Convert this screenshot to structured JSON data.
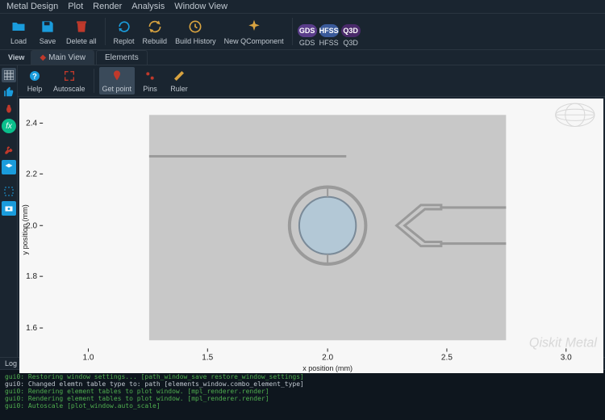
{
  "menu": {
    "items": [
      "Metal Design",
      "Plot",
      "Render",
      "Analysis",
      "Window View"
    ]
  },
  "toolbar": {
    "load": "Load",
    "save": "Save",
    "delete_all": "Delete all",
    "replot": "Replot",
    "rebuild": "Rebuild",
    "build_history": "Build History",
    "new_qc": "New QComponent",
    "gds": "GDS",
    "hfss": "HFSS",
    "q3d": "Q3D"
  },
  "view_label": "View",
  "tabs": {
    "main": "Main View",
    "elements": "Elements"
  },
  "subtoolbar": {
    "help": "Help",
    "autoscale": "Autoscale",
    "get_point": "Get point",
    "pins": "Pins",
    "ruler": "Ruler"
  },
  "plot": {
    "xlabel": "x position (mm)",
    "ylabel": "y position (mm)",
    "watermark": "Qiskit Metal",
    "xticks": [
      "1.0",
      "1.5",
      "2.0",
      "2.5",
      "3.0"
    ],
    "yticks": [
      "1.6",
      "1.8",
      "2.0",
      "2.2",
      "2.4"
    ]
  },
  "log": {
    "header": "Log  (filter >= debug)",
    "lines": [
      {
        "c": "#4fae4f",
        "t": "gui0: Restoring window settings... [path_window_save restore_window_settings]"
      },
      {
        "c": "#c0c8d0",
        "t": "gui0: Changed elemtn table type to:  path [elements_window.combo_element_type]"
      },
      {
        "c": "#4fae4f",
        "t": "gui0: Rendering element tables to plot window. [mpl_renderer.render]"
      },
      {
        "c": "#4fae4f",
        "t": "gui0: Rendering element tables to plot window. [mpl_renderer.render]"
      },
      {
        "c": "#4fae4f",
        "t": "gui0: Autoscale [plot_window.auto_scale]"
      }
    ]
  },
  "colors": {
    "accent": "#1a9cdc",
    "gold": "#d8a340",
    "purple": "#5a3d8a",
    "hfss": "#3a5a9a",
    "q3d": "#4a2a6a",
    "red": "#c0392b",
    "green": "#0abf8c"
  }
}
